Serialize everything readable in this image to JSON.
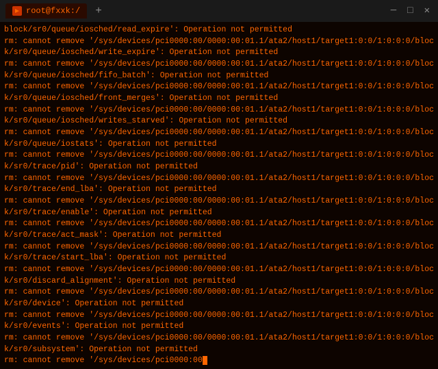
{
  "titlebar": {
    "tab_label": "root@fxxk:/",
    "plus_label": "+",
    "minimize": "─",
    "maximize": "□",
    "close": "✕"
  },
  "terminal": {
    "lines": [
      "block/sr0/queue/iosched/read_expire': Operation not permitted",
      "rm: cannot remove '/sys/devices/pci0000:00/0000:00:01.1/ata2/host1/target1:0:0/1:0:0:0/block/sr0/queue/iosched/write_expire': Operation not permitted",
      "rm: cannot remove '/sys/devices/pci0000:00/0000:00:01.1/ata2/host1/target1:0:0/1:0:0:0/block/sr0/queue/iosched/fifo_batch': Operation not permitted",
      "rm: cannot remove '/sys/devices/pci0000:00/0000:00:01.1/ata2/host1/target1:0:0/1:0:0:0/block/sr0/queue/iosched/front_merges': Operation not permitted",
      "rm: cannot remove '/sys/devices/pci0000:00/0000:00:01.1/ata2/host1/target1:0:0/1:0:0:0/block/sr0/queue/iosched/writes_starved': Operation not permitted",
      "rm: cannot remove '/sys/devices/pci0000:00/0000:00:01.1/ata2/host1/target1:0:0/1:0:0:0/block/sr0/queue/iostats': Operation not permitted",
      "rm: cannot remove '/sys/devices/pci0000:00/0000:00:01.1/ata2/host1/target1:0:0/1:0:0:0/block/sr0/trace/pid': Operation not permitted",
      "rm: cannot remove '/sys/devices/pci0000:00/0000:00:01.1/ata2/host1/target1:0:0/1:0:0:0/block/sr0/trace/end_lba': Operation not permitted",
      "rm: cannot remove '/sys/devices/pci0000:00/0000:00:01.1/ata2/host1/target1:0:0/1:0:0:0/block/sr0/trace/enable': Operation not permitted",
      "rm: cannot remove '/sys/devices/pci0000:00/0000:00:01.1/ata2/host1/target1:0:0/1:0:0:0/block/sr0/trace/act_mask': Operation not permitted",
      "rm: cannot remove '/sys/devices/pci0000:00/0000:00:01.1/ata2/host1/target1:0:0/1:0:0:0/block/sr0/trace/start_lba': Operation not permitted",
      "rm: cannot remove '/sys/devices/pci0000:00/0000:00:01.1/ata2/host1/target1:0:0/1:0:0:0/block/sr0/discard_alignment': Operation not permitted",
      "rm: cannot remove '/sys/devices/pci0000:00/0000:00:01.1/ata2/host1/target1:0:0/1:0:0:0/block/sr0/device': Operation not permitted",
      "rm: cannot remove '/sys/devices/pci0000:00/0000:00:01.1/ata2/host1/target1:0:0/1:0:0:0/block/sr0/events': Operation not permitted",
      "rm: cannot remove '/sys/devices/pci0000:00/0000:00:01.1/ata2/host1/target1:0:0/1:0:0:0/block/sr0/subsystem': Operation not permitted",
      "rm: cannot remove '/sys/devices/pci0000:00"
    ]
  }
}
